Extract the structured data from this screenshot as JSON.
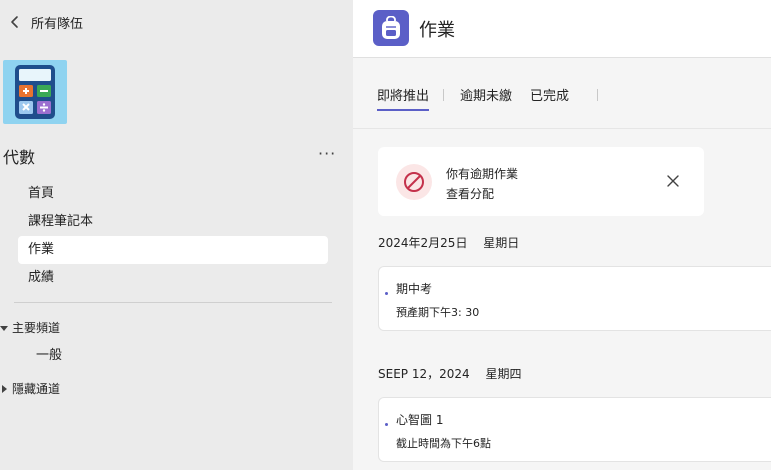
{
  "sidebar": {
    "back_label": "所有隊伍",
    "team_name": "代數",
    "more_label": "···",
    "nav": [
      {
        "label": "首頁"
      },
      {
        "label": "課程筆記本"
      },
      {
        "label": "作業"
      },
      {
        "label": "成績"
      }
    ],
    "sections": [
      {
        "label": "主要頻道",
        "channels": [
          "一般"
        ]
      },
      {
        "label": "隱藏通道"
      }
    ]
  },
  "main": {
    "title": "作業",
    "tabs": [
      {
        "label": "即將推出"
      },
      {
        "label": "逾期未繳"
      },
      {
        "label": "已完成"
      }
    ],
    "alert": {
      "title": "你有逾期作業",
      "link": "查看分配"
    },
    "groups": [
      {
        "date": "2024年2月25日",
        "weekday": "星期日",
        "assignment": {
          "title": "期中考",
          "due": "預產期下午3: 30"
        }
      },
      {
        "date": "SEEP 12，2024",
        "weekday": "星期四",
        "assignment": {
          "title": "心智圖 1",
          "due": "截止時間為下午6點"
        }
      }
    ]
  },
  "colors": {
    "accent": "#5b5fc7",
    "tile": "#8fd3f0",
    "alert_red": "#c4314b"
  },
  "icons": {
    "back": "chevron-left-icon",
    "app": "backpack-icon",
    "alert": "ban-icon",
    "close": "close-icon",
    "team": "calculator-icon"
  }
}
